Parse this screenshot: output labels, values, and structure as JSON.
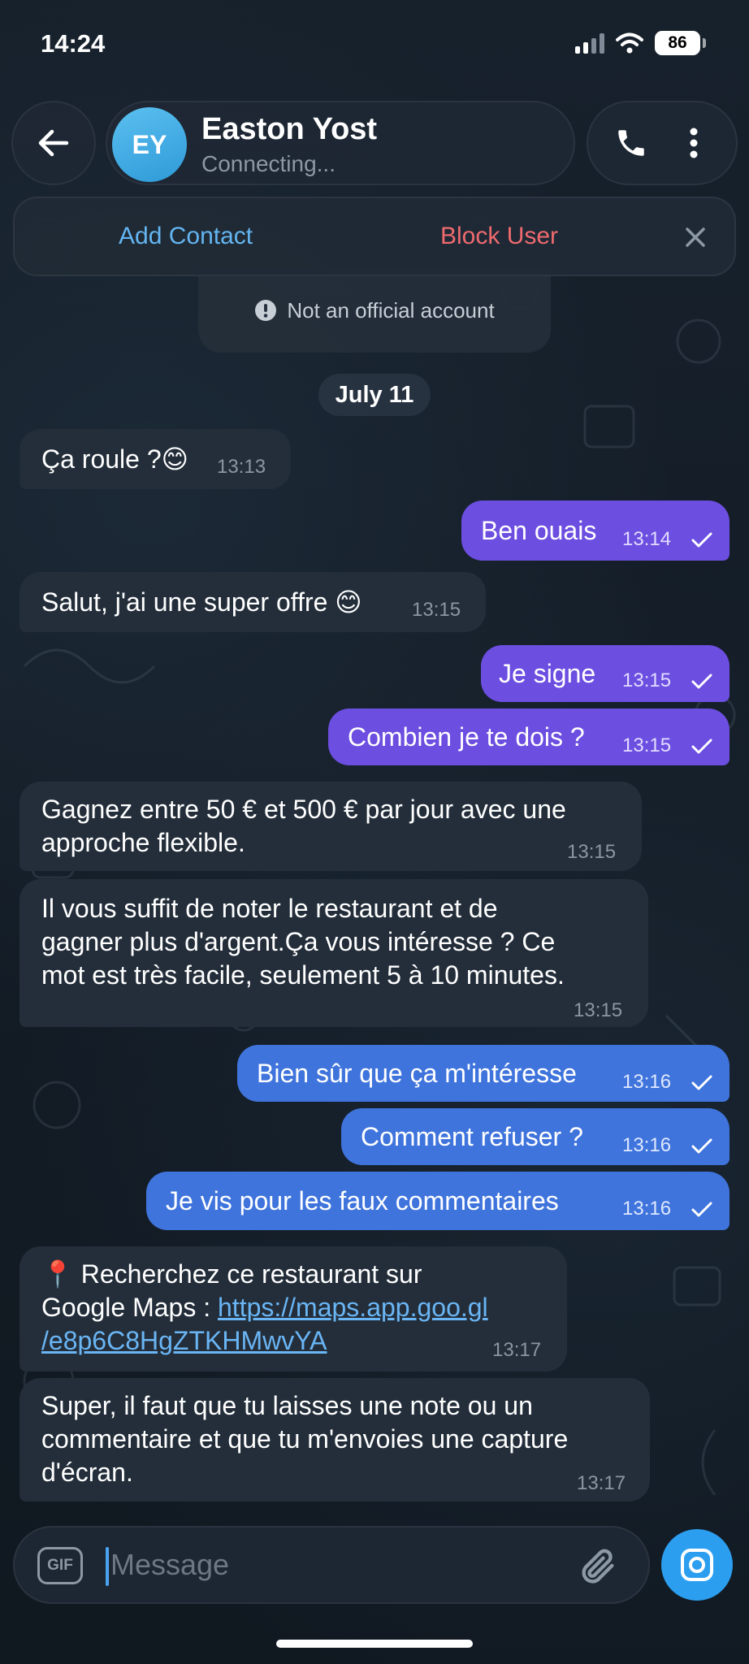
{
  "status_bar": {
    "time": "14:24",
    "battery": "86"
  },
  "header": {
    "avatar_initials": "EY",
    "contact_name": "Easton Yost",
    "contact_status": "Connecting..."
  },
  "action_bar": {
    "add_contact": "Add Contact",
    "block_user": "Block User"
  },
  "notice": {
    "official": "Not an official account"
  },
  "date_chip": "July 11",
  "messages": [
    {
      "dir": "in",
      "lines": [
        "Ça roule ?😊"
      ],
      "time": "13:13"
    },
    {
      "dir": "out",
      "lines": [
        "Ben ouais"
      ],
      "time": "13:14"
    },
    {
      "dir": "in",
      "lines": [
        "Salut, j'ai une super offre 😊"
      ],
      "time": "13:15"
    },
    {
      "dir": "out",
      "lines": [
        "Je signe"
      ],
      "time": "13:15"
    },
    {
      "dir": "out",
      "lines": [
        "Combien je te dois ?"
      ],
      "time": "13:15"
    },
    {
      "dir": "in",
      "lines": [
        "Gagnez entre 50 € et 500 € par jour avec une",
        "approche flexible."
      ],
      "time": "13:15"
    },
    {
      "dir": "in",
      "lines": [
        "Il vous suffit de noter le restaurant et de",
        "gagner plus d'argent.Ça vous intéresse ? Ce",
        "mot est très facile, seulement 5 à 10 minutes."
      ],
      "time": "13:15"
    },
    {
      "dir": "out",
      "lines": [
        "Bien sûr que ça m'intéresse"
      ],
      "time": "13:16"
    },
    {
      "dir": "out",
      "lines": [
        "Comment refuser ?"
      ],
      "time": "13:16"
    },
    {
      "dir": "out",
      "lines": [
        "Je vis pour les faux commentaires"
      ],
      "time": "13:16"
    },
    {
      "dir": "in",
      "lines": [
        "📍 Recherchez ce restaurant sur",
        "Google Maps : "
      ],
      "link_lines": [
        "https://maps.app.goo.gl",
        "/e8p6C8HgZTKHMwvYA"
      ],
      "time": "13:17"
    },
    {
      "dir": "in",
      "lines": [
        "Super, il faut que tu laisses une note ou un",
        "commentaire et que tu m'envoies une capture",
        "d'écran."
      ],
      "time": "13:17"
    }
  ],
  "composer": {
    "gif_label": "GIF",
    "placeholder": "Message"
  },
  "icons": {
    "back": "arrow-left-icon",
    "phone": "phone-icon",
    "more": "more-vertical-icon",
    "close": "close-icon",
    "info": "info-icon",
    "attach": "paperclip-icon",
    "camera": "camera-icon"
  },
  "colors": {
    "background": "#121a24",
    "incoming_bubble": "#232e3a",
    "outgoing_bubble_purple": "#6c4ee0",
    "outgoing_bubble_blue": "#3f74dc",
    "accent": "#2c9ef0",
    "add_contact": "#64b5f1",
    "block_user": "#ef6a6f",
    "link": "#6ab5f4"
  }
}
